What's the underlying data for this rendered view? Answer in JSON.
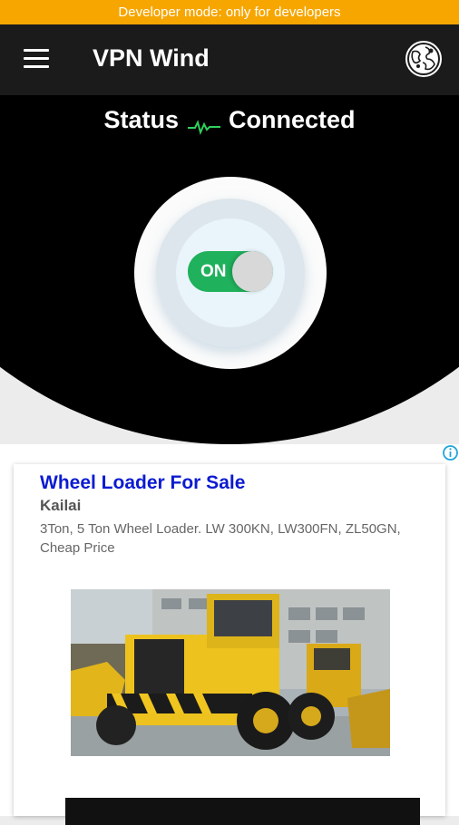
{
  "banner": {
    "text": "Developer mode: only for developers"
  },
  "app_bar": {
    "title": "VPN Wind",
    "menu_icon": "menu-icon",
    "server_icon": "globe-icon"
  },
  "status": {
    "label": "Status",
    "value": "Connected",
    "pulse_icon": "pulse-icon",
    "pulse_color": "#2fd05c"
  },
  "power_toggle": {
    "label": "ON",
    "state": "on",
    "on_color": "#1fb15c"
  },
  "ad": {
    "info_icon": "adchoices-icon",
    "headline": "Wheel Loader For Sale",
    "advertiser": "Kailai",
    "description": "3Ton, 5 Ton Wheel Loader. LW 300KN, LW300FN, ZL50GN, Cheap Price",
    "headline_color": "#0b1bd1"
  }
}
